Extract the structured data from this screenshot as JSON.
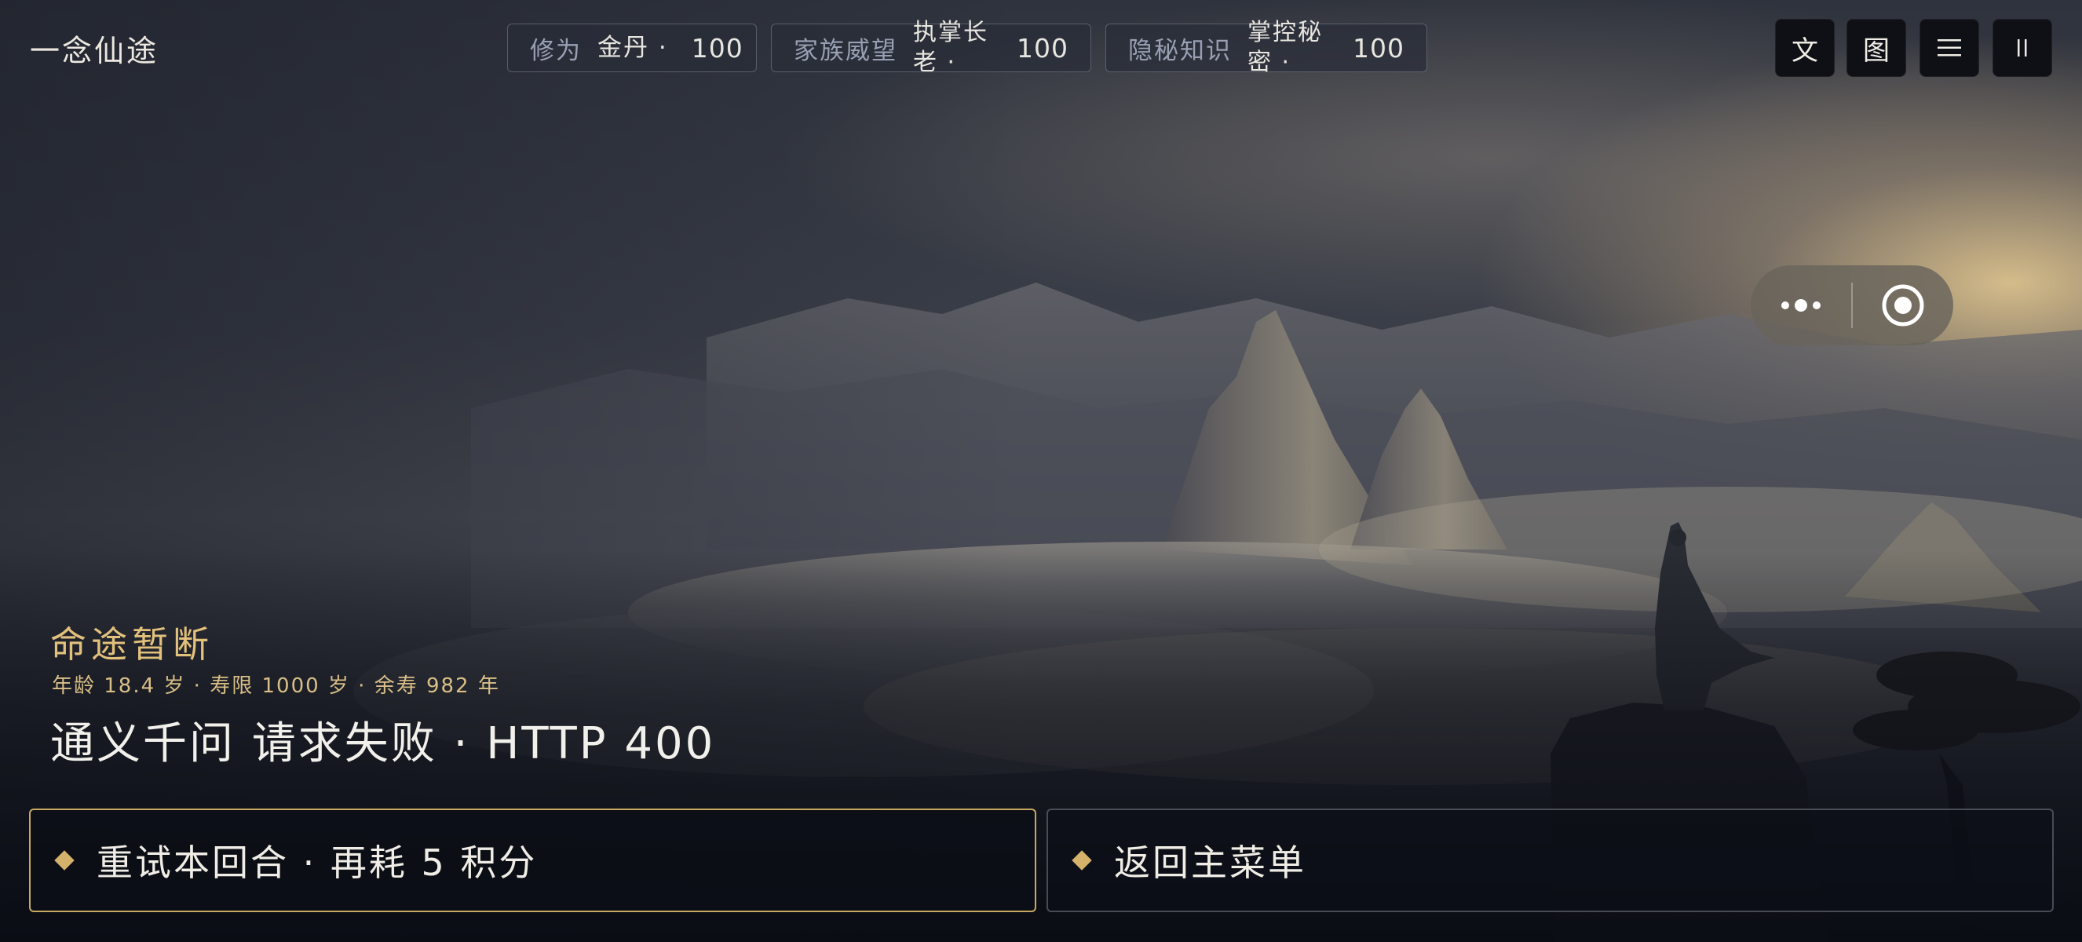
{
  "header": {
    "game_title": "一念仙途"
  },
  "stats": [
    {
      "label": "修为",
      "rank": "金丹 ·",
      "value": "100"
    },
    {
      "label": "家族威望",
      "rank": "执掌长老 ·",
      "value": "100"
    },
    {
      "label": "隐秘知识",
      "rank": "掌控秘密 ·",
      "value": "100"
    }
  ],
  "toolbar": {
    "text_label": "文",
    "map_label": "图",
    "menu_icon": "hamburger-icon",
    "pause_icon": "pause-icon"
  },
  "capsule": {
    "more_icon": "more-dots-icon",
    "close_icon": "target-circle-icon"
  },
  "status": {
    "title": "命途暂断",
    "meta": "年龄 18.4 岁 · 寿限 1000 岁 · 余寿 982 年",
    "message": "通义千问 请求失败 · HTTP 400"
  },
  "choices": [
    {
      "label": "重试本回合 · 再耗 5 积分"
    },
    {
      "label": "返回主菜单"
    }
  ],
  "colors": {
    "accent_gold": "#c9a960",
    "title_gold": "#e2c17c"
  }
}
